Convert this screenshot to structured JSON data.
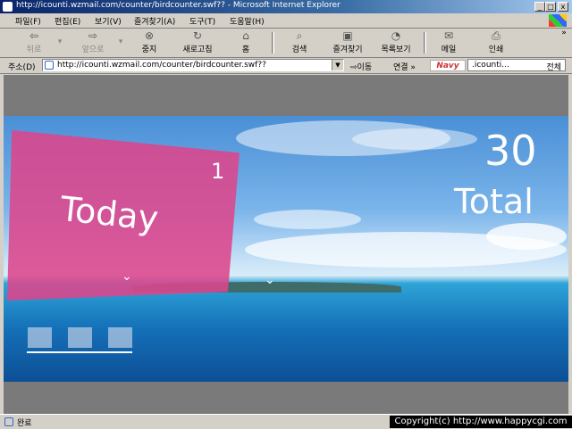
{
  "window": {
    "title": "http://icounti.wzmail.com/counter/birdcounter.swf?? - Microsoft Internet Explorer",
    "minimize": "_",
    "maximize": "□",
    "close": "x"
  },
  "menu": [
    "파일(F)",
    "편집(E)",
    "보기(V)",
    "즐겨찾기(A)",
    "도구(T)",
    "도움말(H)"
  ],
  "toolbar": {
    "back": "뒤로",
    "forward": "앞으로",
    "stop": "중지",
    "refresh": "새로고침",
    "home": "홈",
    "search": "검색",
    "favorites": "즐겨찾기",
    "history": "목록보기",
    "mail": "메일",
    "print": "인쇄"
  },
  "address": {
    "label": "주소(D)",
    "url": "http://icounti.wzmail.com/counter/birdcounter.swf??",
    "go": "이동",
    "links": "연결 »",
    "navy": "Navy",
    "search_value": ".icounti...",
    "search_scope": "전체"
  },
  "counter": {
    "today_label": "Today",
    "today_value": "1",
    "total_value": "30",
    "total_label": "Total"
  },
  "status": {
    "text": "완료",
    "copyright": "Copyright(c) http://www.happycgi.com"
  },
  "colors": {
    "titlebar": "#0a246a",
    "banner": "#dd468c",
    "sky": "#4a8fd6",
    "sea": "#1570b8"
  }
}
